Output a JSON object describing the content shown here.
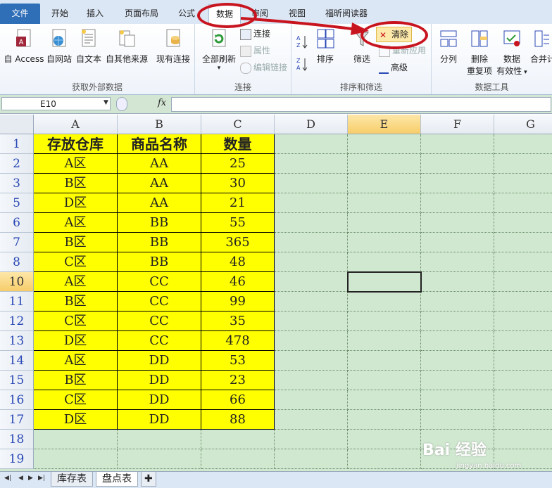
{
  "tabs": [
    {
      "label": "文件"
    },
    {
      "label": "开始"
    },
    {
      "label": "插入"
    },
    {
      "label": "页面布局"
    },
    {
      "label": "公式"
    },
    {
      "label": "数据"
    },
    {
      "label": "审阅"
    },
    {
      "label": "视图"
    },
    {
      "label": "福昕阅读器"
    }
  ],
  "ribbon": {
    "get_external": {
      "label": "获取外部数据",
      "access": "自 Access",
      "web": "自网站",
      "text": "自文本",
      "other": "自其他来源",
      "existing": "现有连接"
    },
    "connections": {
      "label": "连接",
      "refresh_all": "全部刷新",
      "connections": "连接",
      "properties": "属性",
      "edit_links": "编辑链接"
    },
    "sort_filter": {
      "label": "排序和筛选",
      "sort": "排序",
      "filter": "筛选",
      "clear": "清除",
      "reapply": "重新应用",
      "advanced": "高级"
    },
    "data_tools": {
      "label": "数据工具",
      "split": "分列",
      "remove_dup_1": "删除",
      "remove_dup_2": "重复项",
      "validation_1": "数据",
      "validation_2": "有效性",
      "consolidate": "合并计"
    }
  },
  "formula_bar": {
    "name_box": "E10",
    "fx": "fx",
    "value": ""
  },
  "columns": [
    "A",
    "B",
    "C",
    "D",
    "E",
    "F",
    "G"
  ],
  "rows": [
    {
      "num": "1",
      "a": "存放仓库",
      "b": "商品名称",
      "c": "数量"
    },
    {
      "num": "2",
      "a": "A区",
      "b": "AA",
      "c": "25"
    },
    {
      "num": "3",
      "a": "B区",
      "b": "AA",
      "c": "30"
    },
    {
      "num": "5",
      "a": "D区",
      "b": "AA",
      "c": "21"
    },
    {
      "num": "6",
      "a": "A区",
      "b": "BB",
      "c": "55"
    },
    {
      "num": "7",
      "a": "B区",
      "b": "BB",
      "c": "365"
    },
    {
      "num": "8",
      "a": "C区",
      "b": "BB",
      "c": "48"
    },
    {
      "num": "10",
      "a": "A区",
      "b": "CC",
      "c": "46"
    },
    {
      "num": "11",
      "a": "B区",
      "b": "CC",
      "c": "99"
    },
    {
      "num": "12",
      "a": "C区",
      "b": "CC",
      "c": "35"
    },
    {
      "num": "13",
      "a": "D区",
      "b": "CC",
      "c": "478"
    },
    {
      "num": "14",
      "a": "A区",
      "b": "DD",
      "c": "53"
    },
    {
      "num": "15",
      "a": "B区",
      "b": "DD",
      "c": "23"
    },
    {
      "num": "16",
      "a": "C区",
      "b": "DD",
      "c": "66"
    },
    {
      "num": "17",
      "a": "D区",
      "b": "DD",
      "c": "88"
    },
    {
      "num": "18",
      "a": "",
      "b": "",
      "c": ""
    },
    {
      "num": "19",
      "a": "",
      "b": "",
      "c": ""
    }
  ],
  "sheets": [
    {
      "label": "库存表"
    },
    {
      "label": "盘点表"
    }
  ],
  "watermark": {
    "line1": "Bai 经验",
    "line2": "jingyan.baidu.com"
  },
  "colors": {
    "cell_fill": "#ffff00",
    "sheet_bg": "#cfe8cf",
    "annotation": "#c8141e",
    "file_tab": "#2f6fb8"
  }
}
